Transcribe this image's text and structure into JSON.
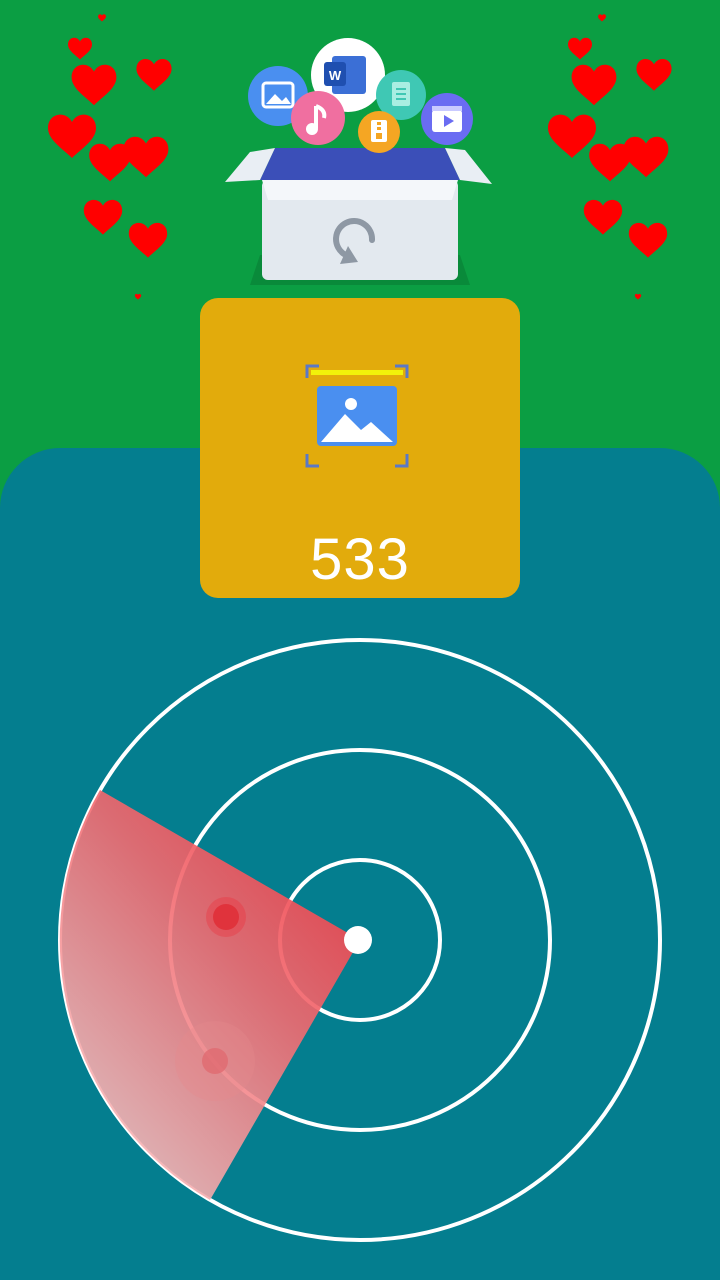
{
  "colors": {
    "top_background": "#0b9e43",
    "panel_background": "#047e8f",
    "card_background": "#e2ab0c",
    "radar_ring": "#ffffff",
    "radar_sweep": "#e8353e",
    "heart": "#ff0000"
  },
  "header": {
    "illustration": "file-recovery-box-illustration",
    "app_icons": [
      "photo-icon",
      "word-document-icon",
      "music-icon",
      "document-icon",
      "zip-archive-icon",
      "video-icon"
    ],
    "box_icon": "restore-icon"
  },
  "scan_card": {
    "icon": "image-scan-icon",
    "count": "533"
  },
  "radar": {
    "icon": "radar-scanner",
    "rings": 3,
    "blips": 2
  }
}
